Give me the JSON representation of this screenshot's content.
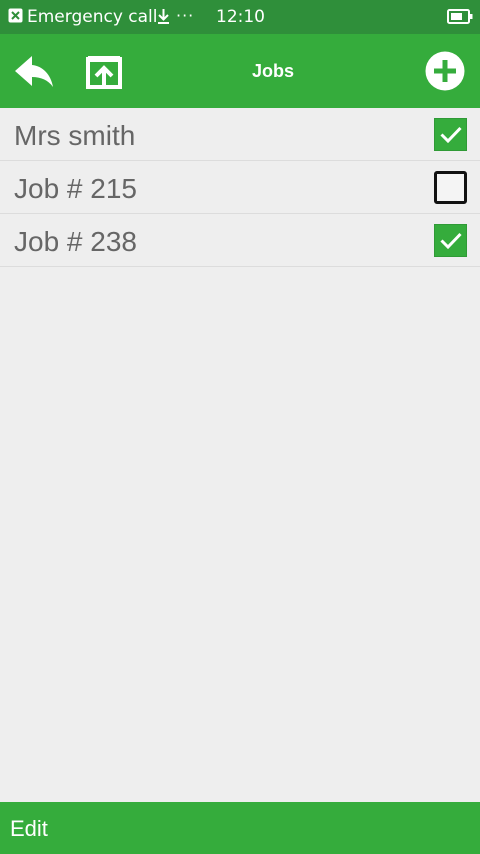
{
  "status_bar": {
    "carrier": "Emergency call",
    "more": "···",
    "time": "12:10",
    "icons": [
      "sim-icon",
      "download-icon",
      "more-icon",
      "battery-icon"
    ]
  },
  "toolbar": {
    "title": "Jobs",
    "icons": [
      "back-icon",
      "share-icon",
      "add-icon"
    ]
  },
  "jobs": [
    {
      "label": "Mrs smith",
      "checked": true
    },
    {
      "label": "Job # 215",
      "checked": false
    },
    {
      "label": "Job # 238",
      "checked": true
    }
  ],
  "bottom_bar": {
    "edit_label": "Edit"
  },
  "colors": {
    "status_bar": "#2f8f3a",
    "accent": "#35ac3c",
    "background": "#eeeeee",
    "list_text": "#666666"
  }
}
